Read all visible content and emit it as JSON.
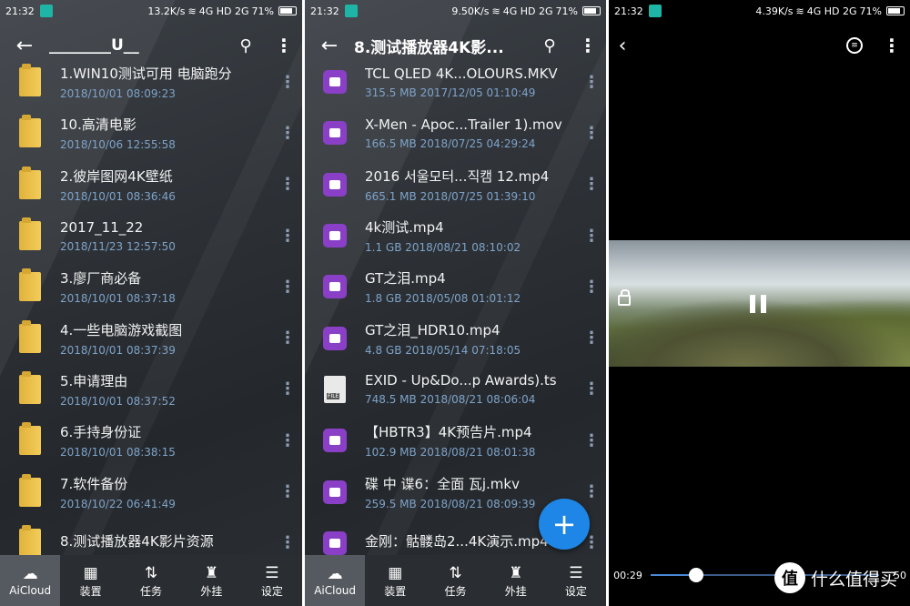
{
  "screen1": {
    "status": {
      "time": "21:32",
      "speed": "13.2K/s",
      "signal": "4G HD  2G",
      "battery": "71%"
    },
    "title": "________U__",
    "items": [
      {
        "name": "1.WIN10测试可用 电脑跑分",
        "meta": "2018/10/01 08:09:23"
      },
      {
        "name": "10.高清电影",
        "meta": "2018/10/06 12:55:58"
      },
      {
        "name": "2.彼岸图网4K壁纸",
        "meta": "2018/10/01 08:36:46"
      },
      {
        "name": "2017_11_22",
        "meta": "2018/11/23 12:57:50"
      },
      {
        "name": "3.廖厂商必备",
        "meta": "2018/10/01 08:37:18"
      },
      {
        "name": "4.一些电脑游戏截图",
        "meta": "2018/10/01 08:37:39"
      },
      {
        "name": "5.申请理由",
        "meta": "2018/10/01 08:37:52"
      },
      {
        "name": "6.手持身份证",
        "meta": "2018/10/01 08:38:15"
      },
      {
        "name": "7.软件备份",
        "meta": "2018/10/22 06:41:49"
      },
      {
        "name": "8.测试播放器4K影片资源",
        "meta": ""
      }
    ]
  },
  "screen2": {
    "status": {
      "time": "21:32",
      "speed": "9.50K/s",
      "signal": "4G HD  2G",
      "battery": "71%"
    },
    "title": "8.测试播放器4K影...",
    "items": [
      {
        "name": "TCL QLED 4K...OLOURS.MKV",
        "meta": "315.5 MB 2017/12/05 01:10:49",
        "icon": "video"
      },
      {
        "name": "X-Men - Apoc...Trailer 1).mov",
        "meta": "166.5 MB 2018/07/25 04:29:24",
        "icon": "video"
      },
      {
        "name": "2016 서울모터...직캠 12.mp4",
        "meta": "665.1 MB 2018/07/25 01:39:10",
        "icon": "video"
      },
      {
        "name": "4k测试.mp4",
        "meta": "1.1 GB 2018/08/21 08:10:02",
        "icon": "video"
      },
      {
        "name": "GT之泪.mp4",
        "meta": "1.8 GB 2018/05/08 01:01:12",
        "icon": "video"
      },
      {
        "name": "GT之泪_HDR10.mp4",
        "meta": "4.8 GB 2018/05/14 07:18:05",
        "icon": "video"
      },
      {
        "name": "EXID - Up&Do...p Awards).ts",
        "meta": "748.5 MB 2018/08/21 08:06:04",
        "icon": "file"
      },
      {
        "name": "【HBTR3】4K预告片.mp4",
        "meta": "102.9 MB 2018/08/21 08:01:38",
        "icon": "video"
      },
      {
        "name": "碟 中 谍6：全面 瓦j.mkv",
        "meta": "259.5 MB 2018/08/21 08:09:39",
        "icon": "video"
      },
      {
        "name": "金刚：骷髅岛2...4K演示.mp4",
        "meta": "",
        "icon": "video"
      }
    ]
  },
  "nav": {
    "tabs": [
      "AiCloud",
      "装置",
      "任务",
      "外挂",
      "设定"
    ]
  },
  "player": {
    "status": {
      "time": "21:32",
      "speed": "4.39K/s",
      "signal": "4G HD  2G",
      "battery": "71%"
    },
    "current_time": "00:29",
    "total_time": "50",
    "progress": 0.2
  },
  "watermark": {
    "badge": "值",
    "text": "什么值得买"
  },
  "colors": {
    "accent": "#1d86e6",
    "meta_text": "#7ea3c9",
    "video_icon": "#8a3fc7",
    "folder": "#f3cc59"
  }
}
